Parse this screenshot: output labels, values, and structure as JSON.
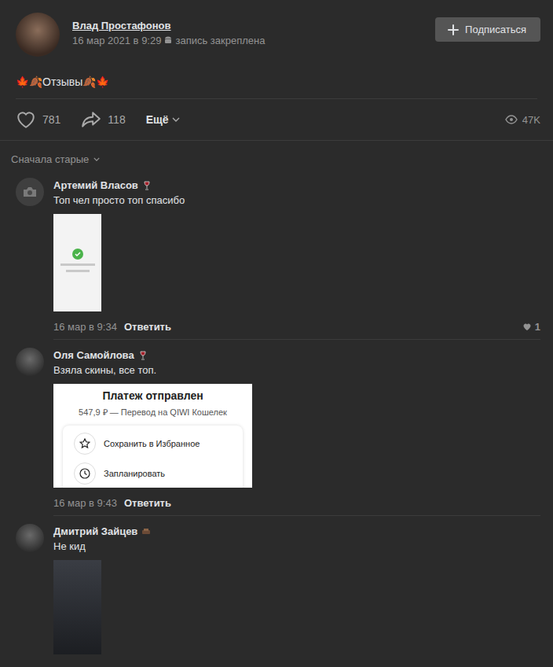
{
  "post": {
    "author": "Влад Простафонов",
    "date": "16 мар 2021 в 9:29",
    "pinned": "запись закреплена",
    "subscribe": "Подписаться",
    "text": "🍁🍂Отзывы🍂🍁",
    "likes": "781",
    "shares": "118",
    "more": "Ещё",
    "views": "47K"
  },
  "sort": {
    "label": "Сначала старые"
  },
  "comments": [
    {
      "author": "Артемий Власов",
      "has_photo": false,
      "text": "Топ чел просто топ спасибо",
      "time": "16 мар в 9:34",
      "reply": "Ответить",
      "likes": "1",
      "attachment": {
        "kind": "phone"
      }
    },
    {
      "author": "Оля Самойлова",
      "has_photo": true,
      "text": "Взяла скины, все топ.",
      "time": "16 мар в 9:43",
      "reply": "Ответить",
      "likes": "",
      "attachment": {
        "kind": "receipt",
        "title": "Платеж отправлен",
        "amount": "547,9 ₽ — Перевод на QIWI Кошелек",
        "actions": [
          "Сохранить в Избранное",
          "Запланировать"
        ]
      }
    },
    {
      "author": "Дмитрий Зайцев",
      "has_photo": true,
      "text": "Не кид",
      "time": "",
      "reply": "",
      "likes": "",
      "attachment": {
        "kind": "dark"
      }
    }
  ]
}
